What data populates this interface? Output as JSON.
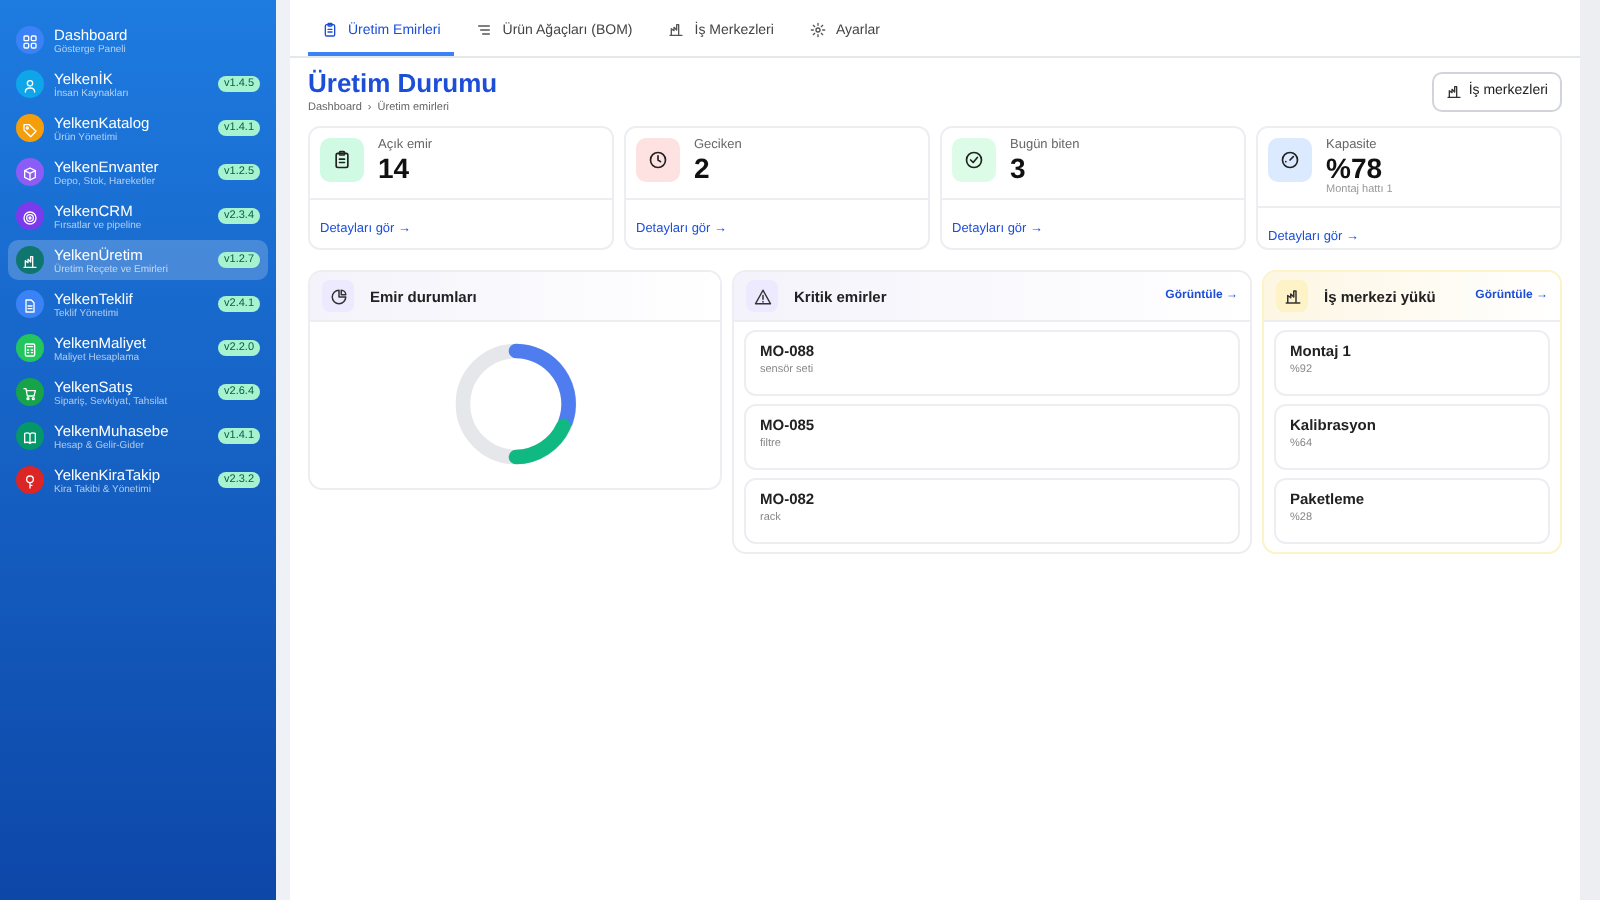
{
  "sidebar": {
    "items": [
      {
        "name": "Dashboard",
        "subtitle": "Gösterge Paneli",
        "color": "#3b82f6",
        "selected": false
      },
      {
        "name": "YelkenİK",
        "subtitle": "İnsan Kaynakları",
        "version": "v1.4.5",
        "color": "#0ea5e9",
        "selected": false
      },
      {
        "name": "YelkenKatalog",
        "subtitle": "Ürün Yönetimi",
        "version": "v1.4.1",
        "color": "#f59e0b",
        "selected": false
      },
      {
        "name": "YelkenEnvanter",
        "subtitle": "Depo, Stok, Hareketler",
        "version": "v1.2.5",
        "color": "#8b5cf6",
        "selected": false
      },
      {
        "name": "YelkenCRM",
        "subtitle": "Fırsatlar ve pipeline",
        "version": "v2.3.4",
        "color": "#7c3aed",
        "selected": false
      },
      {
        "name": "YelkenÜretim",
        "subtitle": "Üretim Reçete ve Emirleri",
        "version": "v1.2.7",
        "color": "#0f766e",
        "selected": true
      },
      {
        "name": "YelkenTeklif",
        "subtitle": "Teklif Yönetimi",
        "version": "v2.4.1",
        "color": "#3b82f6",
        "selected": false
      },
      {
        "name": "YelkenMaliyet",
        "subtitle": "Maliyet Hesaplama",
        "version": "v2.2.0",
        "color": "#22c55e",
        "selected": false
      },
      {
        "name": "YelkenSatış",
        "subtitle": "Sipariş, Sevkiyat, Tahsilat",
        "version": "v2.6.4",
        "color": "#16a34a",
        "selected": false
      },
      {
        "name": "YelkenMuhasebe",
        "subtitle": "Hesap & Gelir-Gider",
        "version": "v1.4.1",
        "color": "#059669",
        "selected": false
      },
      {
        "name": "YelkenKiraTakip",
        "subtitle": "Kira Takibi & Yönetimi",
        "version": "v2.3.2",
        "color": "#dc2626",
        "selected": false
      }
    ]
  },
  "tabs": [
    {
      "label": "Üretim Emirleri",
      "selected": true
    },
    {
      "label": "Ürün Ağaçları (BOM)",
      "selected": false
    },
    {
      "label": "İş Merkezleri",
      "selected": false
    },
    {
      "label": "Ayarlar",
      "selected": false
    }
  ],
  "page": {
    "title": "Üretim Durumu",
    "breadcrumb": {
      "items": [
        "Dashboard",
        "Üretim emirleri"
      ],
      "separator": "›"
    },
    "action_button": "İş merkezleri"
  },
  "stats": [
    {
      "label": "Açık emir",
      "value": "14",
      "color": "#d1fae5",
      "link": "Detayları gör →"
    },
    {
      "label": "Geciken",
      "value": "2",
      "color": "#fee2e2",
      "link": "Detayları gör →"
    },
    {
      "label": "Bugün biten",
      "value": "3",
      "color": "#dcfce7",
      "link": "Detayları gör →"
    },
    {
      "label": "Kapasite",
      "value": "%78",
      "note": "Montaj hattı 1",
      "color": "#dbeafe",
      "link": "Detayları gör →"
    }
  ],
  "panels": [
    {
      "title": "Emir durumları",
      "kind": "donut"
    },
    {
      "title": "Kritik emirler",
      "kind": "list",
      "link": "Görüntüle →",
      "items": [
        {
          "title": "MO-088",
          "subtitle": "sensör seti"
        },
        {
          "title": "MO-085",
          "subtitle": "filtre"
        },
        {
          "title": "MO-082",
          "subtitle": "rack"
        }
      ]
    },
    {
      "title": "İş merkezi yükü",
      "kind": "list",
      "link": "Görüntüle →",
      "items": [
        {
          "title": "Montaj 1",
          "subtitle": "%92"
        },
        {
          "title": "Kalibrasyon",
          "subtitle": "%64"
        },
        {
          "title": "Paketleme",
          "subtitle": "%28"
        }
      ]
    }
  ]
}
